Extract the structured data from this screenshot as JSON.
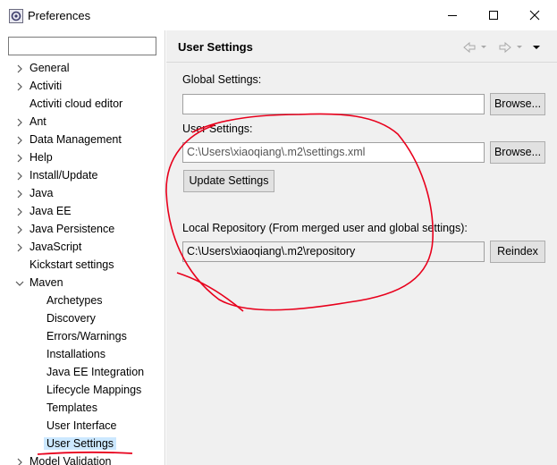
{
  "window": {
    "title": "Preferences"
  },
  "filter": {
    "value": ""
  },
  "tree": [
    {
      "label": "General",
      "level": 0,
      "expandable": true
    },
    {
      "label": "Activiti",
      "level": 0,
      "expandable": true
    },
    {
      "label": "Activiti cloud editor",
      "level": 0,
      "expandable": false
    },
    {
      "label": "Ant",
      "level": 0,
      "expandable": true
    },
    {
      "label": "Data Management",
      "level": 0,
      "expandable": true
    },
    {
      "label": "Help",
      "level": 0,
      "expandable": true
    },
    {
      "label": "Install/Update",
      "level": 0,
      "expandable": true
    },
    {
      "label": "Java",
      "level": 0,
      "expandable": true
    },
    {
      "label": "Java EE",
      "level": 0,
      "expandable": true
    },
    {
      "label": "Java Persistence",
      "level": 0,
      "expandable": true
    },
    {
      "label": "JavaScript",
      "level": 0,
      "expandable": true
    },
    {
      "label": "Kickstart settings",
      "level": 0,
      "expandable": false
    },
    {
      "label": "Maven",
      "level": 0,
      "expandable": true,
      "expanded": true
    },
    {
      "label": "Archetypes",
      "level": 1,
      "expandable": false
    },
    {
      "label": "Discovery",
      "level": 1,
      "expandable": false
    },
    {
      "label": "Errors/Warnings",
      "level": 1,
      "expandable": false
    },
    {
      "label": "Installations",
      "level": 1,
      "expandable": false
    },
    {
      "label": "Java EE Integration",
      "level": 1,
      "expandable": false
    },
    {
      "label": "Lifecycle Mappings",
      "level": 1,
      "expandable": false
    },
    {
      "label": "Templates",
      "level": 1,
      "expandable": false
    },
    {
      "label": "User Interface",
      "level": 1,
      "expandable": false
    },
    {
      "label": "User Settings",
      "level": 1,
      "expandable": false,
      "selected": true
    },
    {
      "label": "Model Validation",
      "level": 0,
      "expandable": true
    }
  ],
  "page": {
    "title": "User Settings",
    "global_settings_label": "Global Settings:",
    "global_settings_value": "",
    "user_settings_label": "User Settings:",
    "user_settings_value": "C:\\Users\\xiaoqiang\\.m2\\settings.xml",
    "update_settings_button": "Update Settings",
    "local_repo_label": "Local Repository (From merged user and global settings):",
    "local_repo_value": "C:\\Users\\xiaoqiang\\.m2\\repository",
    "browse_button": "Browse...",
    "reindex_button": "Reindex"
  },
  "colors": {
    "annotation": "#e8001c",
    "selection": "#cce8ff"
  }
}
